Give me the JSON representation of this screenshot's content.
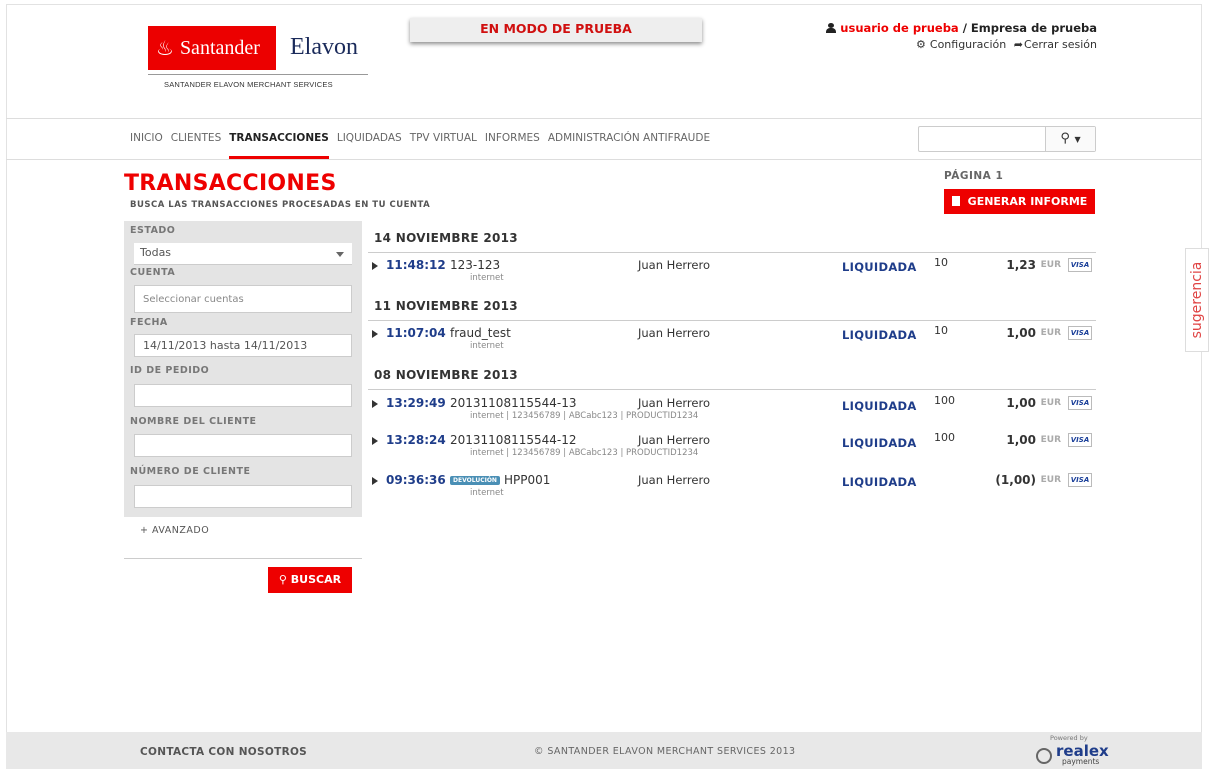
{
  "header": {
    "brand_left": "Santander",
    "brand_right": "Elavon",
    "brand_sub": "SANTANDER ELAVON MERCHANT SERVICES",
    "test_banner": "EN MODO DE PRUEBA",
    "user_name": "usuario de prueba",
    "separator": " / ",
    "company": "Empresa de prueba",
    "settings_label": "Configuración",
    "logout_label": "Cerrar sesión"
  },
  "nav": {
    "items": [
      "INICIO",
      "CLIENTES",
      "TRANSACCIONES",
      "LIQUIDADAS",
      "TPV VIRTUAL",
      "INFORMES",
      "ADMINISTRACIÓN ANTIFRAUDE"
    ],
    "active": "TRANSACCIONES",
    "search_value": ""
  },
  "page": {
    "title": "TRANSACCIONES",
    "subtitle": "BUSCA LAS TRANSACCIONES PROCESADAS EN TU CUENTA",
    "pagina": "PÁGINA 1",
    "generate_btn": "GENERAR INFORME"
  },
  "filter": {
    "estado_label": "ESTADO",
    "estado_value": "Todas",
    "cuenta_label": "CUENTA",
    "cuenta_placeholder": "Seleccionar cuentas",
    "fecha_label": "FECHA",
    "fecha_value": "14/11/2013 hasta 14/11/2013",
    "pedido_label": "ID DE PEDIDO",
    "nombre_label": "NOMBRE DEL CLIENTE",
    "numero_label": "NÚMERO DE CLIENTE",
    "advanced": "+ AVANZADO",
    "buscar_btn": "BUSCAR"
  },
  "transactions": {
    "groups": [
      {
        "date": "14 NOVIEMBRE 2013",
        "rows": [
          {
            "time": "11:48:12",
            "ref": "123-123",
            "sub": "internet",
            "customer": "Juan Herrero",
            "status": "LIQUIDADA",
            "code": "10",
            "amount": "1,23",
            "currency": "EUR",
            "card": "VISA"
          }
        ]
      },
      {
        "date": "11 NOVIEMBRE 2013",
        "rows": [
          {
            "time": "11:07:04",
            "ref": "fraud_test",
            "sub": "internet",
            "customer": "Juan Herrero",
            "status": "LIQUIDADA",
            "code": "10",
            "amount": "1,00",
            "currency": "EUR",
            "card": "VISA"
          }
        ]
      },
      {
        "date": "08 NOVIEMBRE 2013",
        "rows": [
          {
            "time": "13:29:49",
            "ref": "20131108115544-13",
            "sub": "internet | 123456789 | ABCabc123 | PRODUCTID1234",
            "customer": "Juan Herrero",
            "status": "LIQUIDADA",
            "code": "100",
            "amount": "1,00",
            "currency": "EUR",
            "card": "VISA"
          },
          {
            "time": "13:28:24",
            "ref": "20131108115544-12",
            "sub": "internet | 123456789 | ABCabc123 | PRODUCTID1234",
            "customer": "Juan Herrero",
            "status": "LIQUIDADA",
            "code": "100",
            "amount": "1,00",
            "currency": "EUR",
            "card": "VISA"
          },
          {
            "time": "09:36:36",
            "badge": "DEVOLUCIÓN",
            "ref": "HPP001",
            "sub": "internet",
            "customer": "Juan Herrero",
            "status": "LIQUIDADA",
            "code": "",
            "amount": "(1,00)",
            "currency": "EUR",
            "card": "VISA"
          }
        ]
      }
    ]
  },
  "side_tab": "sugerencia",
  "footer": {
    "contact": "CONTACTA CON NOSOTROS",
    "copyright": "© SANTANDER ELAVON MERCHANT SERVICES 2013",
    "powered": "Powered by",
    "realex": "realex",
    "payments": "payments"
  },
  "colors": {
    "brand_red": "#ec0000",
    "link_blue": "#1f3d8a"
  }
}
